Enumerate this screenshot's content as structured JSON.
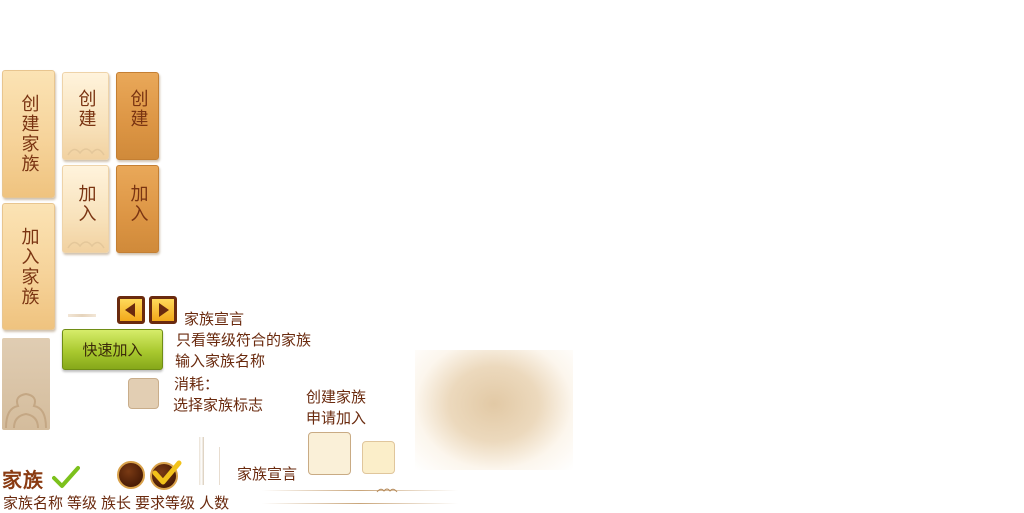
{
  "tabs": {
    "create_family_big": "创建家族",
    "join_family_big": "加入家族",
    "create_small": "创建",
    "create_small_active": "创建",
    "join_small": "加入",
    "join_small_active": "加入"
  },
  "labels": {
    "family_declaration_top": "家族宣言",
    "only_matching_level": "只看等级符合的家族",
    "input_family_name": "输入家族名称",
    "cost": "消耗：",
    "choose_family_emblem": "选择家族标志",
    "create_family": "创建家族",
    "apply_join": "申请加入",
    "family_declaration_bottom": "家族宣言",
    "family_title": "家族"
  },
  "buttons": {
    "quick_join": "快速加入"
  },
  "table": {
    "columns": [
      "家族名称",
      "等级",
      "族长",
      "要求等级",
      "人数"
    ]
  },
  "colors": {
    "text_brown": "#6a2a0e",
    "green_check": "#7cc11c",
    "arrow_gold": "#f2a81a"
  }
}
